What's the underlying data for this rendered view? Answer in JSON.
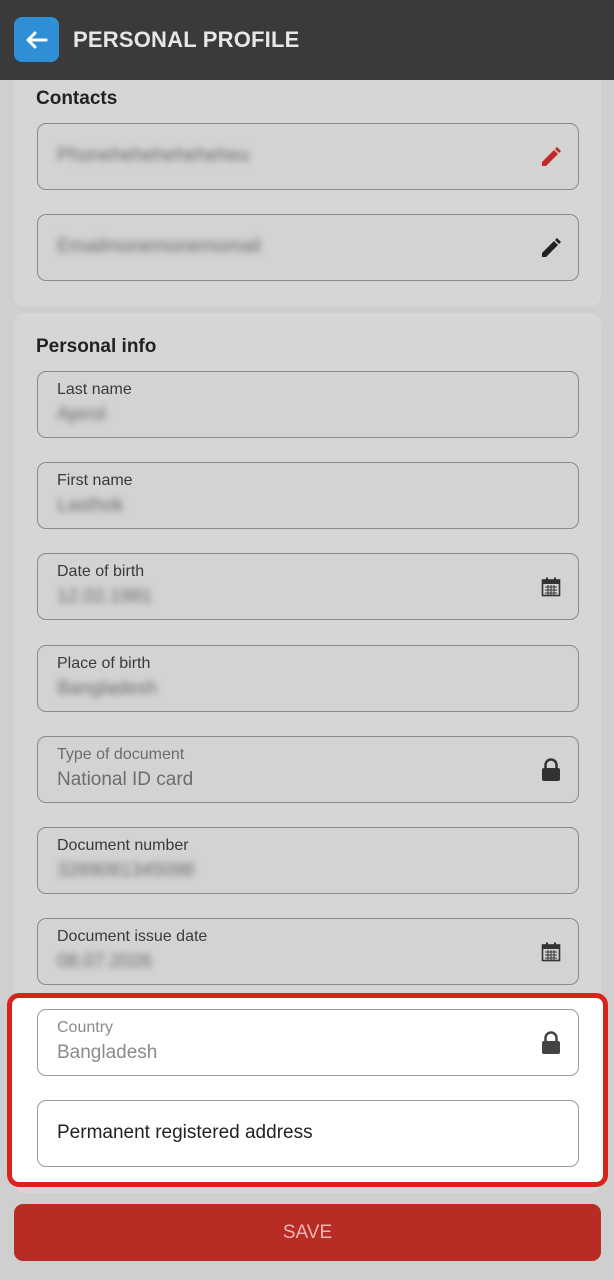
{
  "header": {
    "title": "PERSONAL PROFILE",
    "back_icon": "arrow-left-icon"
  },
  "contacts": {
    "title": "Contacts",
    "phone": {
      "value": "Phoneheheheheheheu",
      "icon": "pencil-icon",
      "icon_color": "#c0282a"
    },
    "email": {
      "value": "Emailmonemonemomail",
      "icon": "pencil-icon",
      "icon_color": "#222222"
    }
  },
  "personal": {
    "title": "Personal info",
    "last_name": {
      "label": "Last name",
      "value": "Ajerol"
    },
    "first_name": {
      "label": "First name",
      "value": "Lasthok"
    },
    "date_of_birth": {
      "label": "Date of birth",
      "value": "12.02.1981",
      "icon": "calendar-icon"
    },
    "place_of_birth": {
      "label": "Place of birth",
      "value": "Bangladesh"
    },
    "document_type": {
      "label": "Type of document",
      "value": "National ID card",
      "icon": "lock-icon"
    },
    "document_number": {
      "label": "Document number",
      "value": "3289081345098"
    },
    "document_issue_date": {
      "label": "Document issue date",
      "value": "08.07.2026",
      "icon": "calendar-icon"
    },
    "country": {
      "label": "Country",
      "value": "Bangladesh",
      "icon": "lock-icon"
    },
    "address": {
      "placeholder": "Permanent registered address"
    }
  },
  "actions": {
    "save_label": "SAVE"
  },
  "colors": {
    "header_bg": "#3a3a3a",
    "back_button": "#2f8fd6",
    "save_button": "#b92b25",
    "highlight_border": "#d8231b"
  }
}
